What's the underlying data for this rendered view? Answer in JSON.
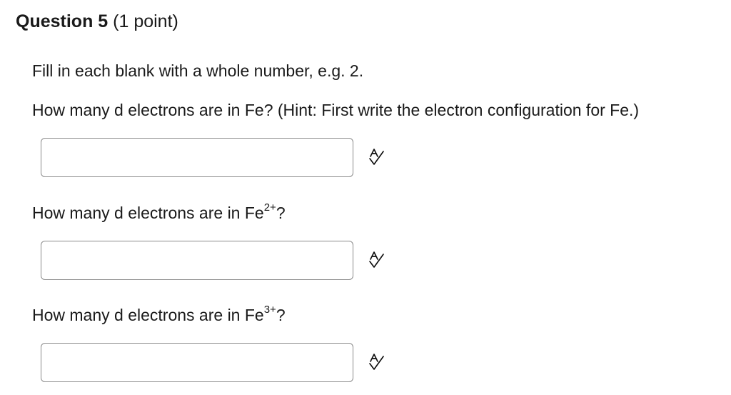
{
  "question": {
    "number_label": "Question 5",
    "points_label": "(1 point)"
  },
  "instructions": "Fill in each blank with a whole number, e.g. 2.",
  "items": [
    {
      "prompt": "How many d electrons are in Fe? (Hint:  First write the electron configuration for Fe.)",
      "answer_value": "",
      "icon": "spellcheck-icon"
    },
    {
      "prompt_prefix": "How many d electrons are in Fe",
      "prompt_sup": "2+",
      "prompt_suffix": "?",
      "answer_value": "",
      "icon": "spellcheck-icon"
    },
    {
      "prompt_prefix": "How many d electrons are in Fe",
      "prompt_sup": "3+",
      "prompt_suffix": "?",
      "answer_value": "",
      "icon": "spellcheck-icon"
    }
  ]
}
